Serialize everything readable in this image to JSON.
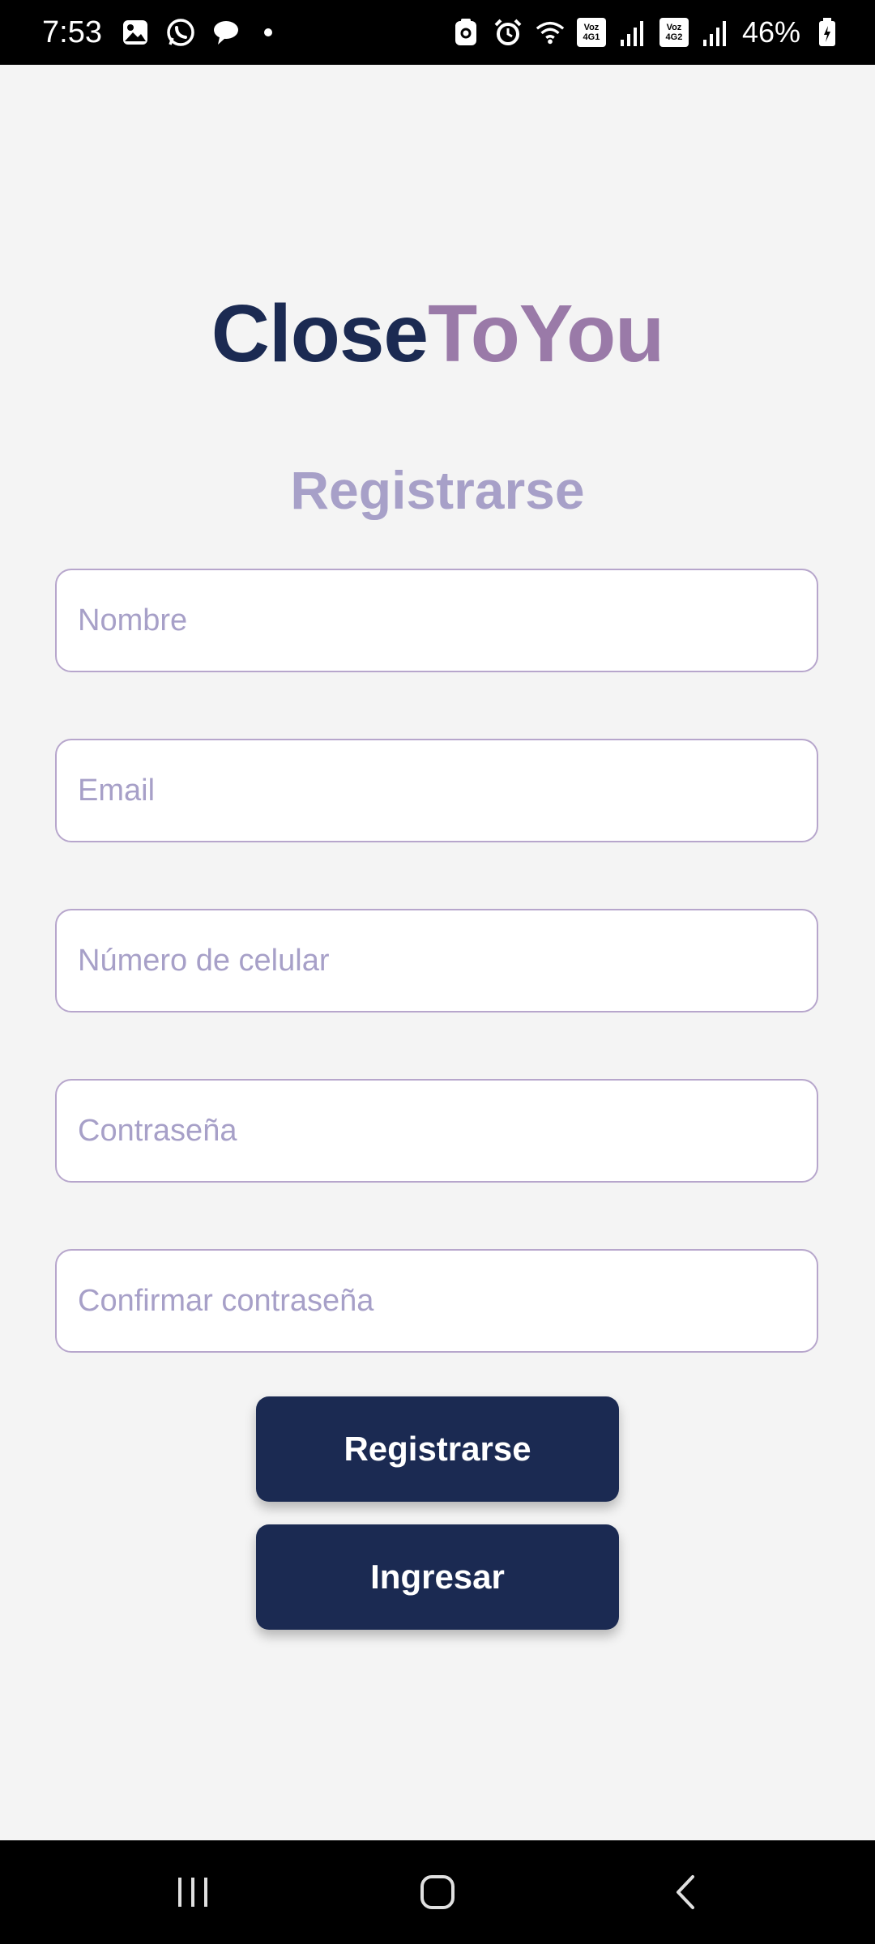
{
  "status_bar": {
    "time": "7:53",
    "battery": "46%",
    "voz_top": "Voz",
    "voz_bottom_1": "4G1",
    "voz_bottom_2": "4G2",
    "icons": [
      "gallery-icon",
      "whatsapp-icon",
      "chat-icon",
      "dot-icon",
      "save-icon",
      "alarm-icon",
      "wifi-icon",
      "signal-icon",
      "battery-icon"
    ]
  },
  "logo": {
    "part1": "Close",
    "part2": "ToYou"
  },
  "title": "Registrarse",
  "form": {
    "name_placeholder": "Nombre",
    "email_placeholder": "Email",
    "phone_placeholder": "Número de celular",
    "password_placeholder": "Contraseña",
    "confirm_password_placeholder": "Confirmar contraseña"
  },
  "buttons": {
    "register": "Registrarse",
    "login": "Ingresar"
  },
  "colors": {
    "primary": "#1b2a52",
    "accent": "#9a7aa8",
    "title": "#a7a0c8",
    "background": "#f4f4f4"
  },
  "nav": {
    "icons": [
      "recent-apps-icon",
      "home-icon",
      "back-icon"
    ]
  }
}
